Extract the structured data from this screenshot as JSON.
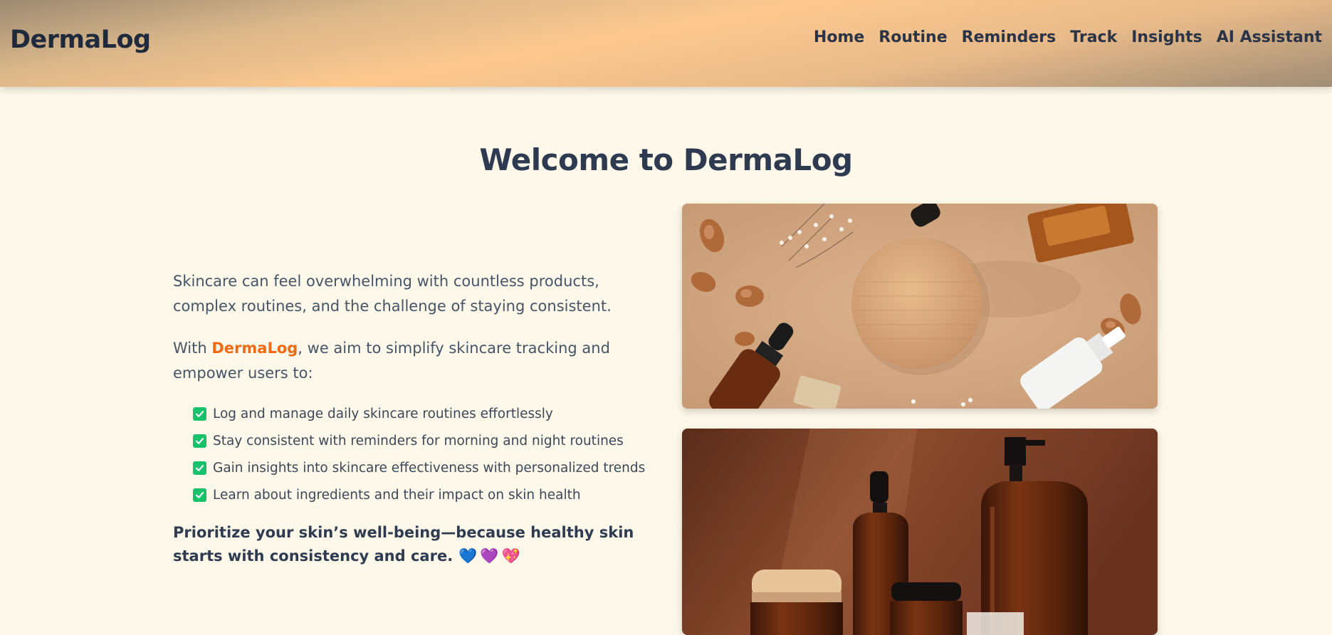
{
  "header": {
    "logo": "DermaLog",
    "nav": [
      "Home",
      "Routine",
      "Reminders",
      "Track",
      "Insights",
      "AI Assistant"
    ]
  },
  "main": {
    "title": "Welcome to DermaLog",
    "para1": "Skincare can feel overwhelming with countless products, complex routines, and the challenge of staying consistent.",
    "para2_prefix": "With ",
    "para2_brand": "DermaLog",
    "para2_suffix": ", we aim to simplify skincare tracking and empower users to:",
    "features": [
      "Log and manage daily skincare routines effortlessly",
      "Stay consistent with reminders for morning and night routines",
      "Gain insights into skincare effectiveness with personalized trends",
      "Learn about ingredients and their impact on skin health"
    ],
    "closing": "Prioritize your skin’s well-being—because healthy skin starts with consistency and care.",
    "hearts": "💙💜💖"
  },
  "colors": {
    "brand": "#ef6a12",
    "check": "#18c26b",
    "background": "#fdf8e9"
  },
  "icons": [
    "checkbox-icon",
    "blue-heart-icon",
    "purple-heart-icon",
    "sparkling-heart-icon"
  ]
}
